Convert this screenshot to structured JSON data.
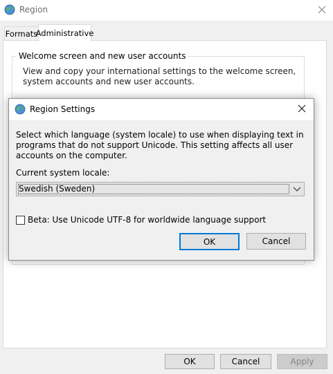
{
  "window": {
    "title": "Region",
    "tabs": [
      {
        "label": "Formats"
      },
      {
        "label": "Administrative"
      }
    ],
    "welcome_group": {
      "legend": "Welcome screen and new user accounts",
      "text": "View and copy your international settings to the welcome screen, system accounts and new user accounts."
    },
    "buttons": {
      "ok": "OK",
      "cancel": "Cancel",
      "apply": "Apply"
    }
  },
  "dialog": {
    "title": "Region Settings",
    "description": "Select which language (system locale) to use when displaying text in programs that do not support Unicode. This setting affects all user accounts on the computer.",
    "locale_label": "Current system locale:",
    "locale_value": "Swedish (Sweden)",
    "utf8_label": "Beta: Use Unicode UTF-8 for worldwide language support",
    "utf8_checked": false,
    "ok": "OK",
    "cancel": "Cancel"
  },
  "icons": {
    "globe": "globe-icon",
    "close": "close-icon",
    "dropdown": "chevron-down-icon"
  },
  "colors": {
    "focus_border": "#0078d7",
    "disabled_text": "#838383"
  }
}
